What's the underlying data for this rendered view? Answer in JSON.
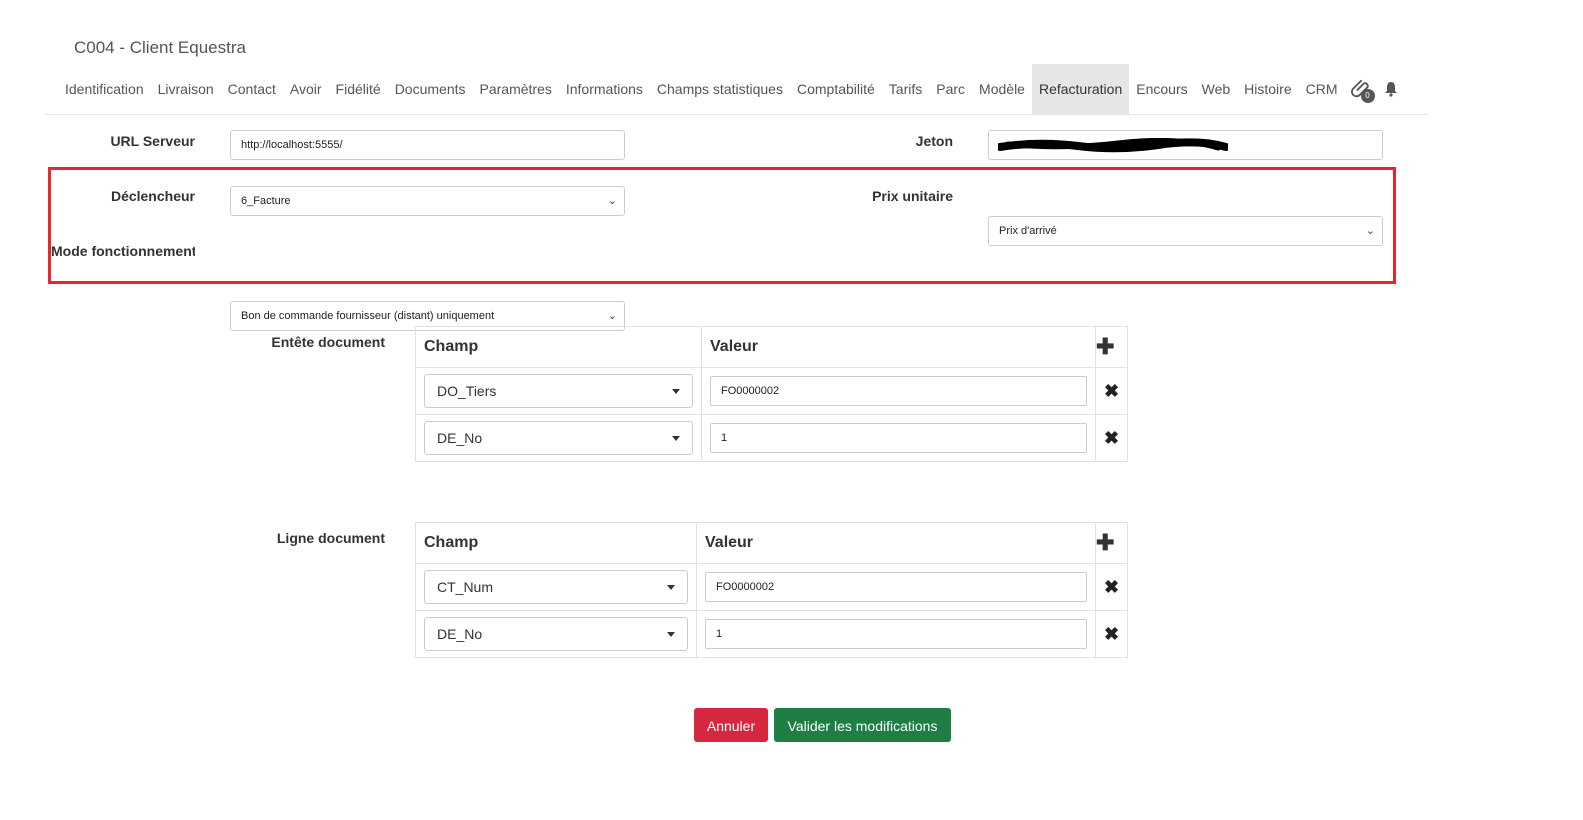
{
  "page": {
    "title": "C004 - Client Equestra"
  },
  "tabs": [
    {
      "label": "Identification"
    },
    {
      "label": "Livraison"
    },
    {
      "label": "Contact"
    },
    {
      "label": "Avoir"
    },
    {
      "label": "Fidélité"
    },
    {
      "label": "Documents"
    },
    {
      "label": "Paramètres"
    },
    {
      "label": "Informations"
    },
    {
      "label": "Champs statistiques"
    },
    {
      "label": "Comptabilité"
    },
    {
      "label": "Tarifs"
    },
    {
      "label": "Parc"
    },
    {
      "label": "Modèle"
    },
    {
      "label": "Refacturation",
      "active": true
    },
    {
      "label": "Encours"
    },
    {
      "label": "Web"
    },
    {
      "label": "Histoire"
    },
    {
      "label": "CRM"
    }
  ],
  "tab_icons": {
    "attachment_icon": "paperclip-icon",
    "attachment_count": "0",
    "bell_icon": "bell-icon"
  },
  "form": {
    "url_label": "URL Serveur",
    "url_value": "http://localhost:5555/",
    "token_label": "Jeton",
    "token_value": "",
    "trigger_label": "Déclencheur",
    "trigger_value": "6_Facture",
    "price_label": "Prix unitaire",
    "price_value": "Prix d'arrivé",
    "mode_label": "Mode fonctionnement",
    "mode_value": "Bon de commande fournisseur (distant) uniquement"
  },
  "header_table": {
    "label": "Entête document",
    "col_field": "Champ",
    "col_value": "Valeur",
    "rows": [
      {
        "field": "DO_Tiers",
        "value": "FO0000002"
      },
      {
        "field": "DE_No",
        "value": "1"
      }
    ]
  },
  "line_table": {
    "label": "Ligne document",
    "col_field": "Champ",
    "col_value": "Valeur",
    "rows": [
      {
        "field": "CT_Num",
        "value": "FO0000002"
      },
      {
        "field": "DE_No",
        "value": "1"
      }
    ]
  },
  "actions": {
    "cancel": "Annuler",
    "save": "Valider les modifications"
  },
  "colors": {
    "highlight": "#e8262c",
    "cancel": "#d7263f",
    "save": "#1e7e43",
    "active_tab": "#e6e6e6"
  }
}
